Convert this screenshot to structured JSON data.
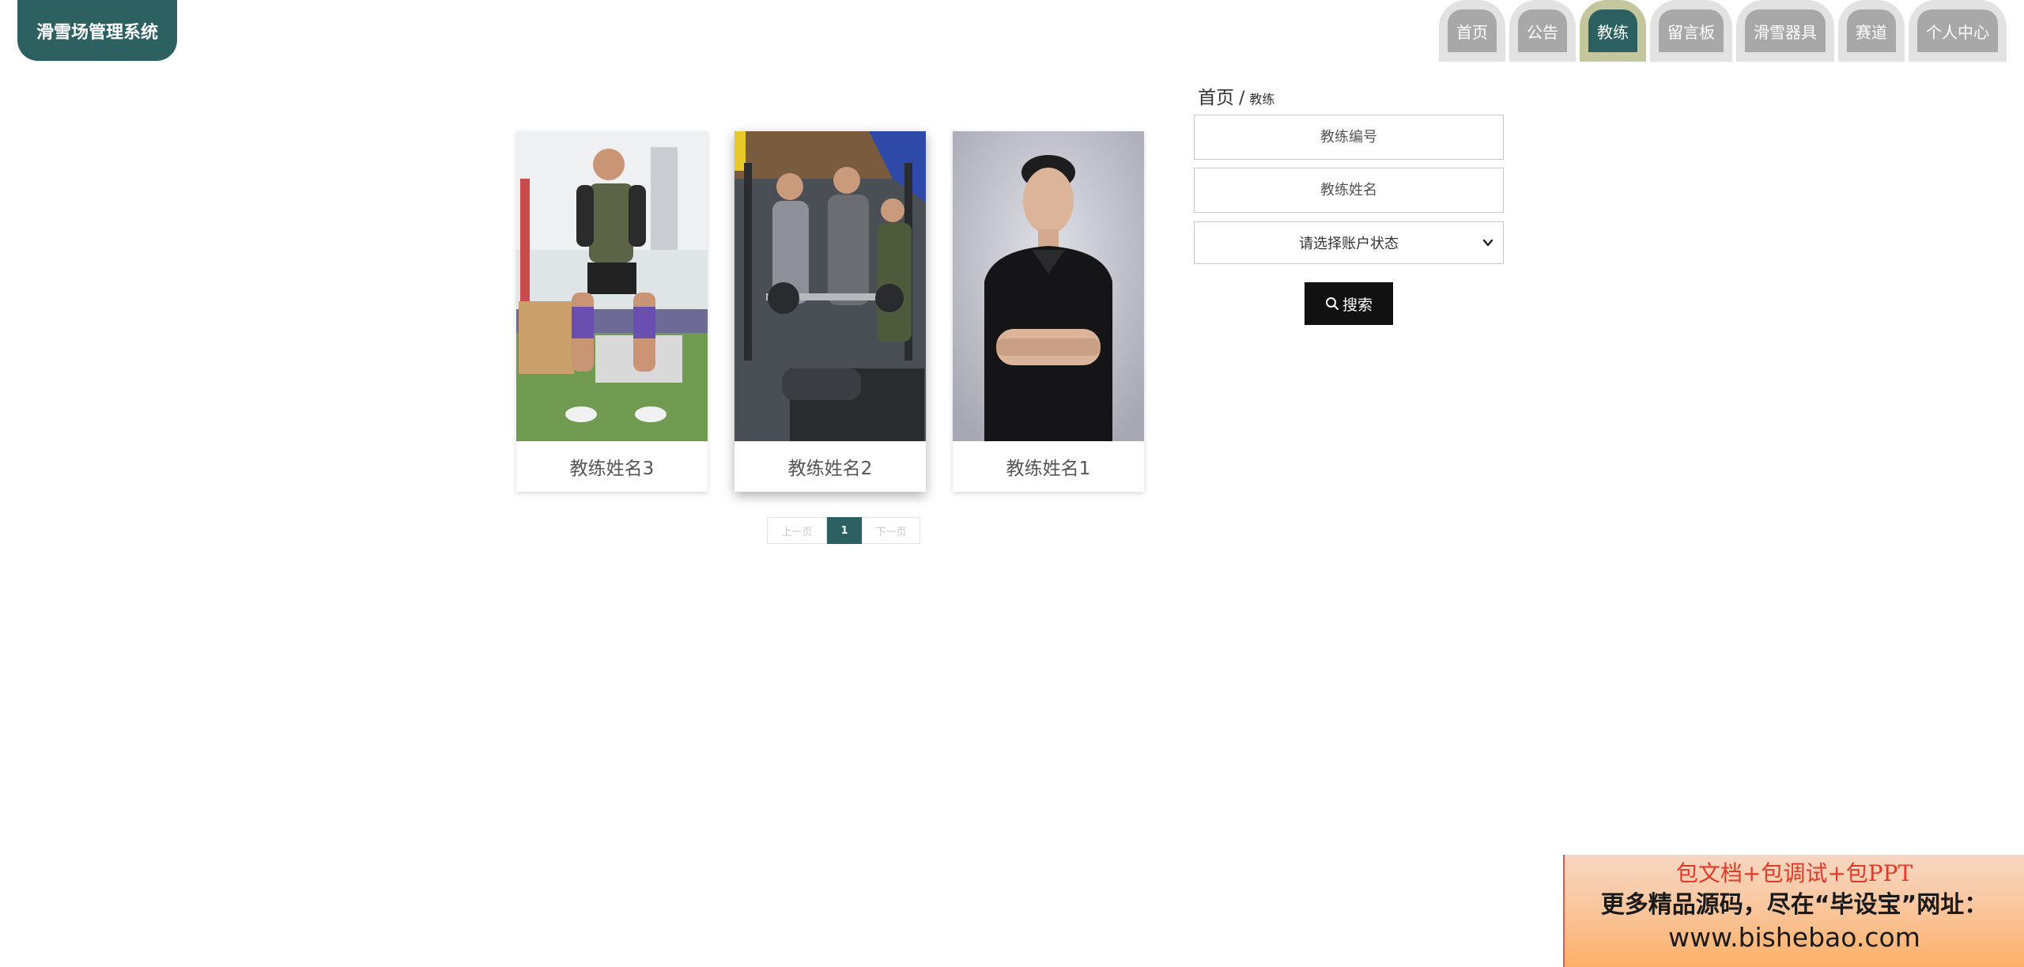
{
  "app": {
    "title": "滑雪场管理系统"
  },
  "nav": {
    "items": [
      {
        "label": "首页",
        "active": false
      },
      {
        "label": "公告",
        "active": false
      },
      {
        "label": "教练",
        "active": true
      },
      {
        "label": "留言板",
        "active": false
      },
      {
        "label": "滑雪器具",
        "active": false
      },
      {
        "label": "赛道",
        "active": false
      },
      {
        "label": "个人中心",
        "active": false
      }
    ]
  },
  "breadcrumb": {
    "home": "首页",
    "separator": "/",
    "current": "教练"
  },
  "coaches": [
    {
      "name": "教练姓名3"
    },
    {
      "name": "教练姓名2"
    },
    {
      "name": "教练姓名1"
    }
  ],
  "pagination": {
    "prev": "上一页",
    "current": "1",
    "next": "下一页"
  },
  "search": {
    "coach_no_placeholder": "教练编号",
    "coach_name_placeholder": "教练姓名",
    "status_select": "请选择账户状态",
    "button": "搜索"
  },
  "promo": {
    "line1": "包文档+包调试+包PPT",
    "line2": "更多精品源码，尽在“毕设宝”网址：",
    "line3": "www.bishebao.com"
  },
  "colors": {
    "primary": "#2d6060",
    "nav_inactive": "#a8a8a8",
    "active_ring": "#c4c69d"
  }
}
